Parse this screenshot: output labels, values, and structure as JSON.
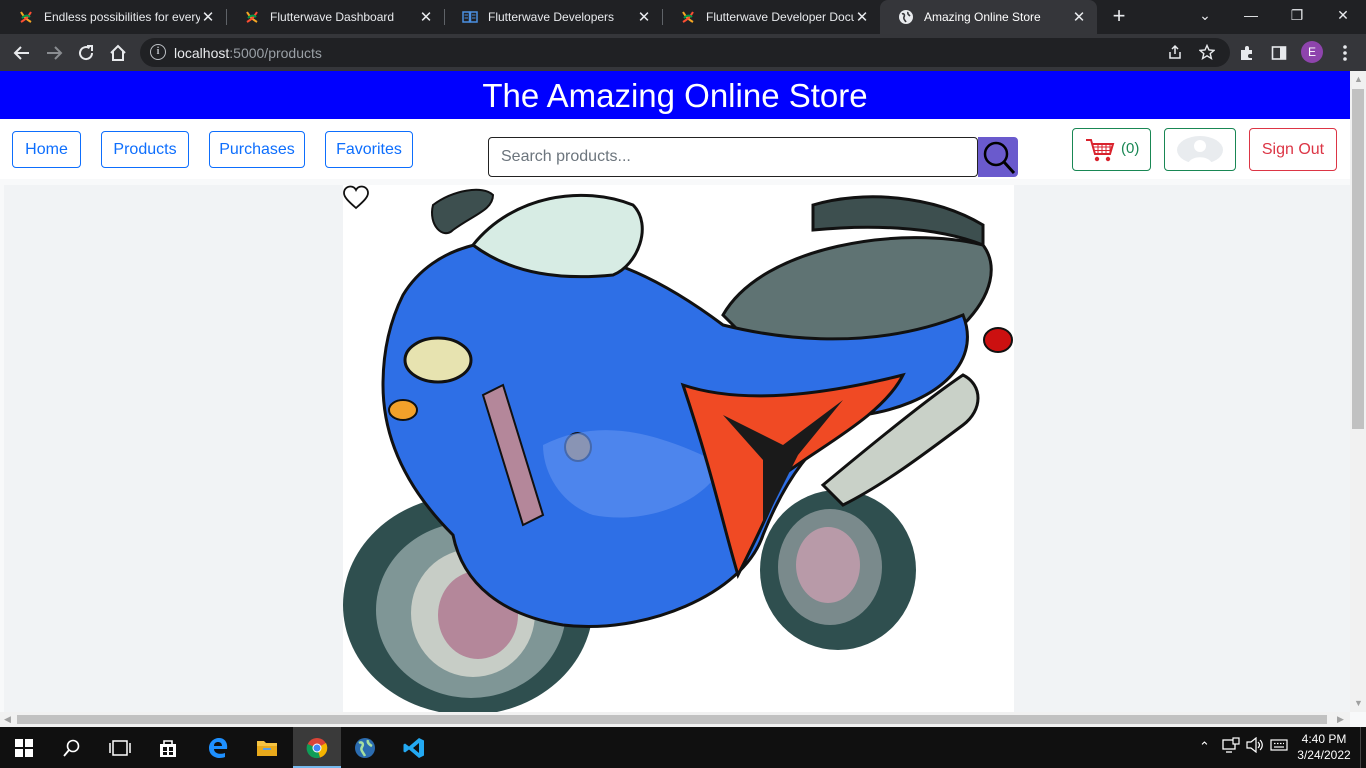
{
  "browser": {
    "tabs": [
      {
        "title": "Endless possibilities for every",
        "active": false
      },
      {
        "title": "Flutterwave Dashboard",
        "active": false
      },
      {
        "title": "Flutterwave Developers",
        "active": false
      },
      {
        "title": "Flutterwave Developer Docum",
        "active": false
      },
      {
        "title": "Amazing Online Store",
        "active": true
      }
    ],
    "url_host": "localhost",
    "url_path": ":5000/products",
    "profile_initial": "E"
  },
  "store": {
    "title": "The Amazing Online Store",
    "nav": [
      "Home",
      "Products",
      "Purchases",
      "Favorites"
    ],
    "search_placeholder": "Search products...",
    "cart_count": "(0)",
    "sign_out": "Sign Out"
  },
  "colors": {
    "banner": "#0000ff",
    "primary": "#0d6efd",
    "success": "#198754",
    "danger": "#dc3545"
  },
  "taskbar": {
    "time": "4:40 PM",
    "date": "3/24/2022"
  }
}
